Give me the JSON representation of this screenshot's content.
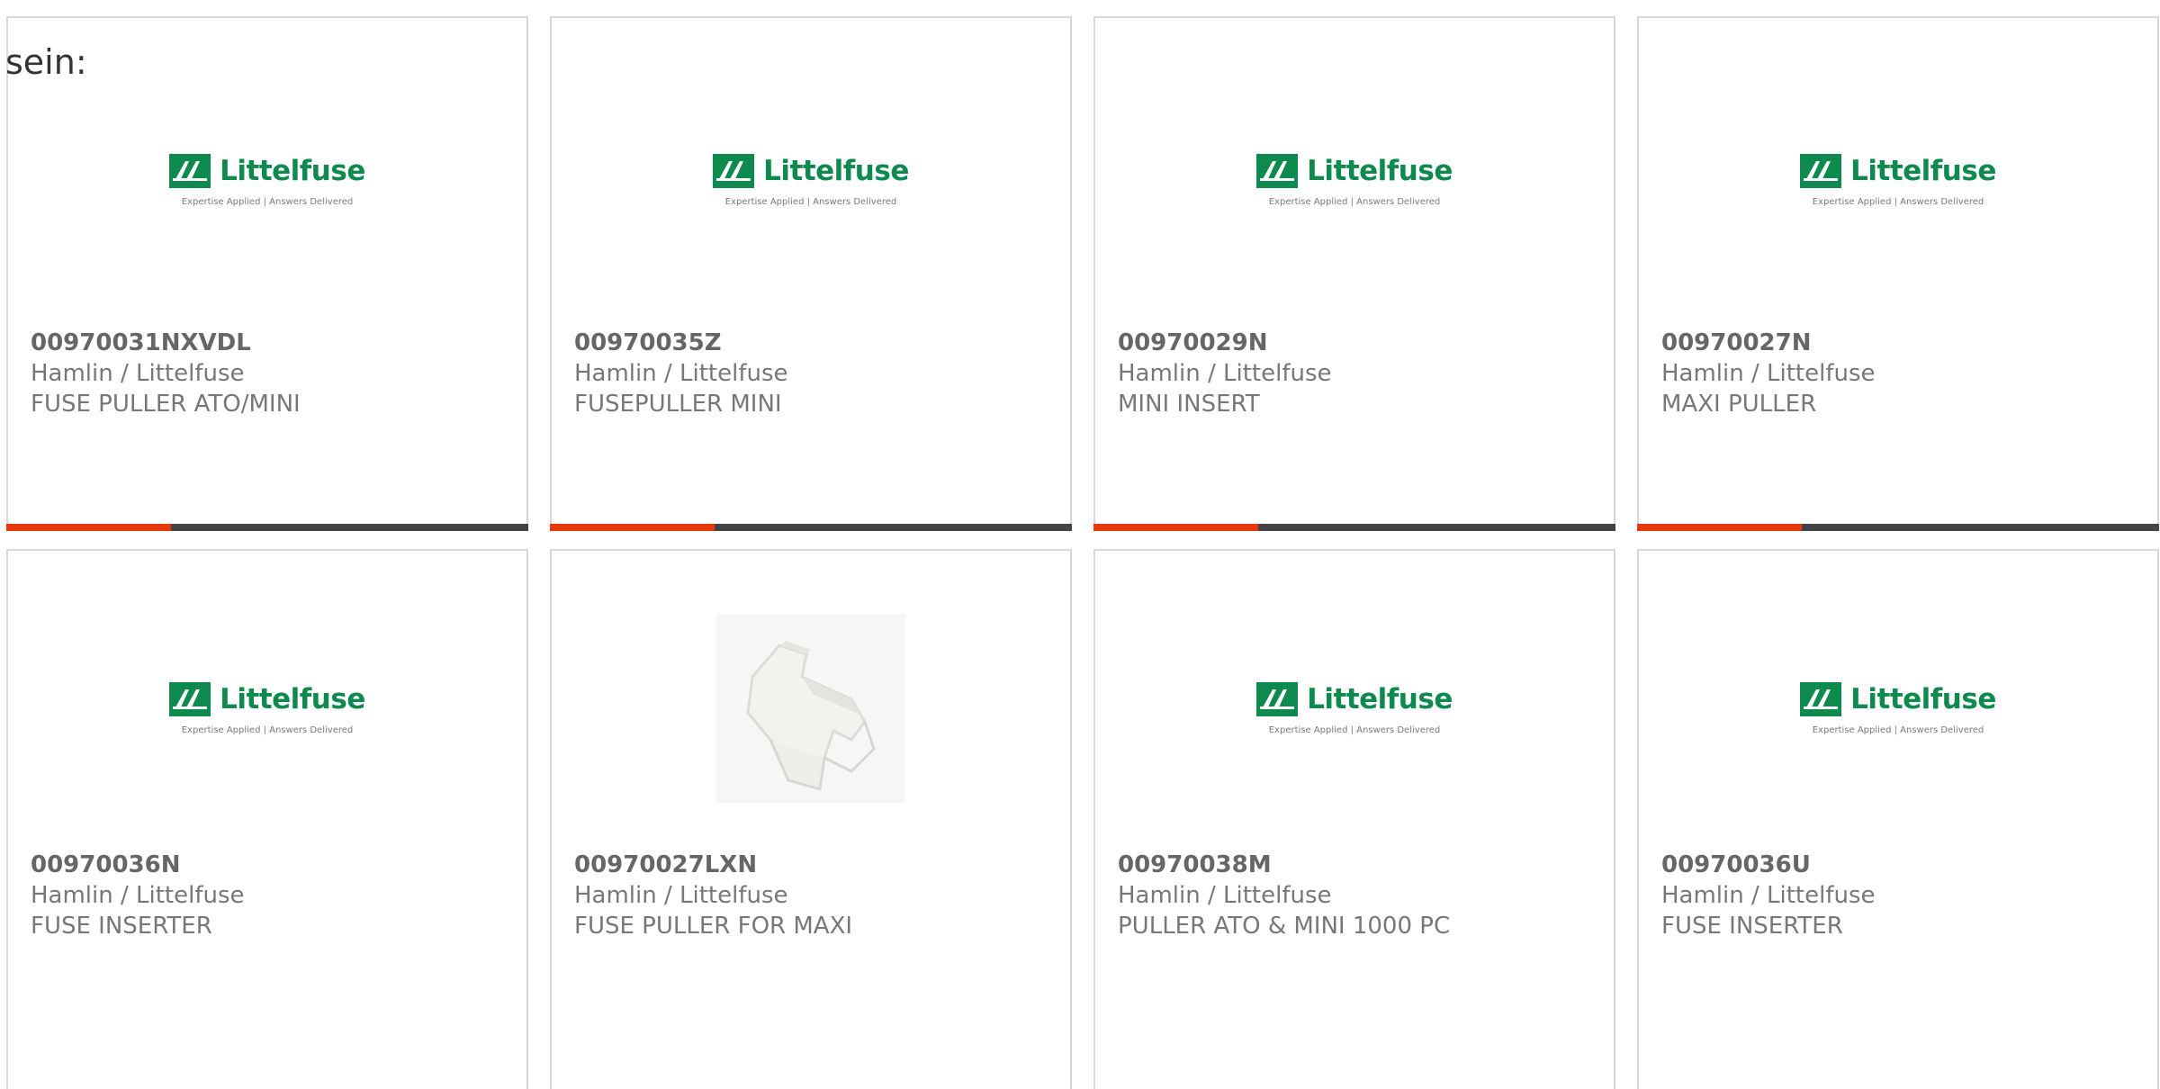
{
  "intro_text": "sein:",
  "brand_logo": {
    "word": "Littelfuse",
    "tagline": "Expertise Applied | Answers Delivered",
    "color": "#0e8a4f"
  },
  "accent_colors": {
    "highlight": "#e8380d",
    "bar": "#444444"
  },
  "products": [
    {
      "part": "00970031NXVDL",
      "maker": "Hamlin / Littelfuse",
      "desc": "FUSE PULLER ATO/MINI",
      "image": "littelfuse-logo"
    },
    {
      "part": "00970035Z",
      "maker": "Hamlin / Littelfuse",
      "desc": "FUSEPULLER MINI",
      "image": "littelfuse-logo"
    },
    {
      "part": "00970029N",
      "maker": "Hamlin / Littelfuse",
      "desc": "MINI INSERT",
      "image": "littelfuse-logo"
    },
    {
      "part": "00970027N",
      "maker": "Hamlin / Littelfuse",
      "desc": "MAXI PULLER",
      "image": "littelfuse-logo"
    },
    {
      "part": "00970036N",
      "maker": "Hamlin / Littelfuse",
      "desc": "FUSE INSERTER",
      "image": "littelfuse-logo"
    },
    {
      "part": "00970027LXN",
      "maker": "Hamlin / Littelfuse",
      "desc": "FUSE PULLER FOR MAXI",
      "image": "fuse-puller-photo"
    },
    {
      "part": "00970038M",
      "maker": "Hamlin / Littelfuse",
      "desc": "PULLER ATO & MINI 1000 PC",
      "image": "littelfuse-logo"
    },
    {
      "part": "00970036U",
      "maker": "Hamlin / Littelfuse",
      "desc": "FUSE INSERTER",
      "image": "littelfuse-logo"
    }
  ]
}
